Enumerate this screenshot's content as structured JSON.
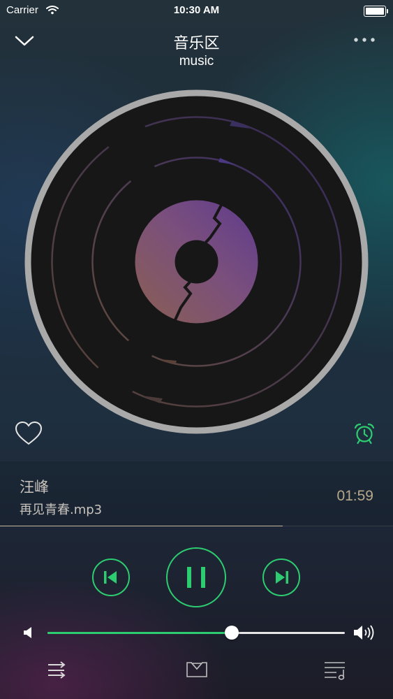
{
  "status_bar": {
    "carrier": "Carrier",
    "time": "10:30 AM"
  },
  "header": {
    "title": "音乐区",
    "subtitle": "music"
  },
  "track": {
    "artist": "汪峰",
    "filename": "再见青春.mp3",
    "time": "01:59",
    "progress": 0.72
  },
  "volume": {
    "level": 0.62
  },
  "controls": {
    "state": "playing"
  },
  "colors": {
    "accent": "#2ecc71",
    "time_text": "#b8a88a",
    "disc_ring": "#a9a9a9",
    "disc_body": "#171717"
  },
  "icons": [
    "chevron-down-icon",
    "more-icon",
    "heart-icon",
    "alarm-clock-icon",
    "previous-icon",
    "pause-icon",
    "next-icon",
    "volume-low-icon",
    "volume-high-icon",
    "shuffle-icon",
    "download-icon",
    "playlist-icon",
    "wifi-icon",
    "battery-icon"
  ]
}
